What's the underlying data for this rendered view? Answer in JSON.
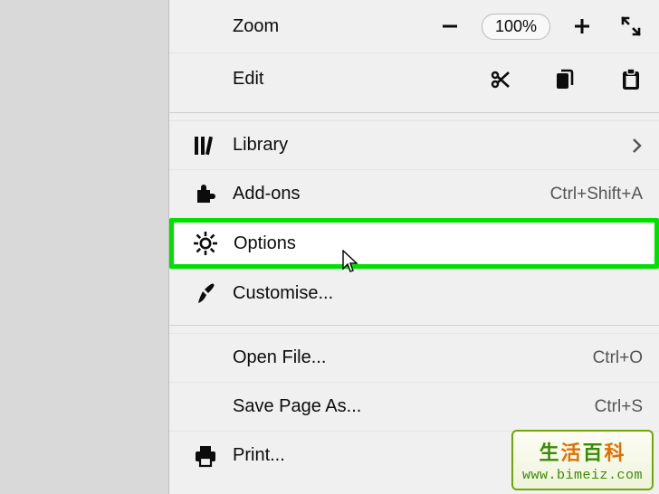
{
  "menu": {
    "zoom": {
      "label": "Zoom",
      "value": "100%"
    },
    "edit": {
      "label": "Edit"
    },
    "library": {
      "label": "Library"
    },
    "addons": {
      "label": "Add-ons",
      "shortcut": "Ctrl+Shift+A"
    },
    "options": {
      "label": "Options"
    },
    "customise": {
      "label": "Customise..."
    },
    "open_file": {
      "label": "Open File...",
      "shortcut": "Ctrl+O"
    },
    "save_page": {
      "label": "Save Page As...",
      "shortcut": "Ctrl+S"
    },
    "print": {
      "label": "Print..."
    }
  },
  "watermark": {
    "title_cn": "生活百科",
    "url": "www.bimeiz.com"
  }
}
